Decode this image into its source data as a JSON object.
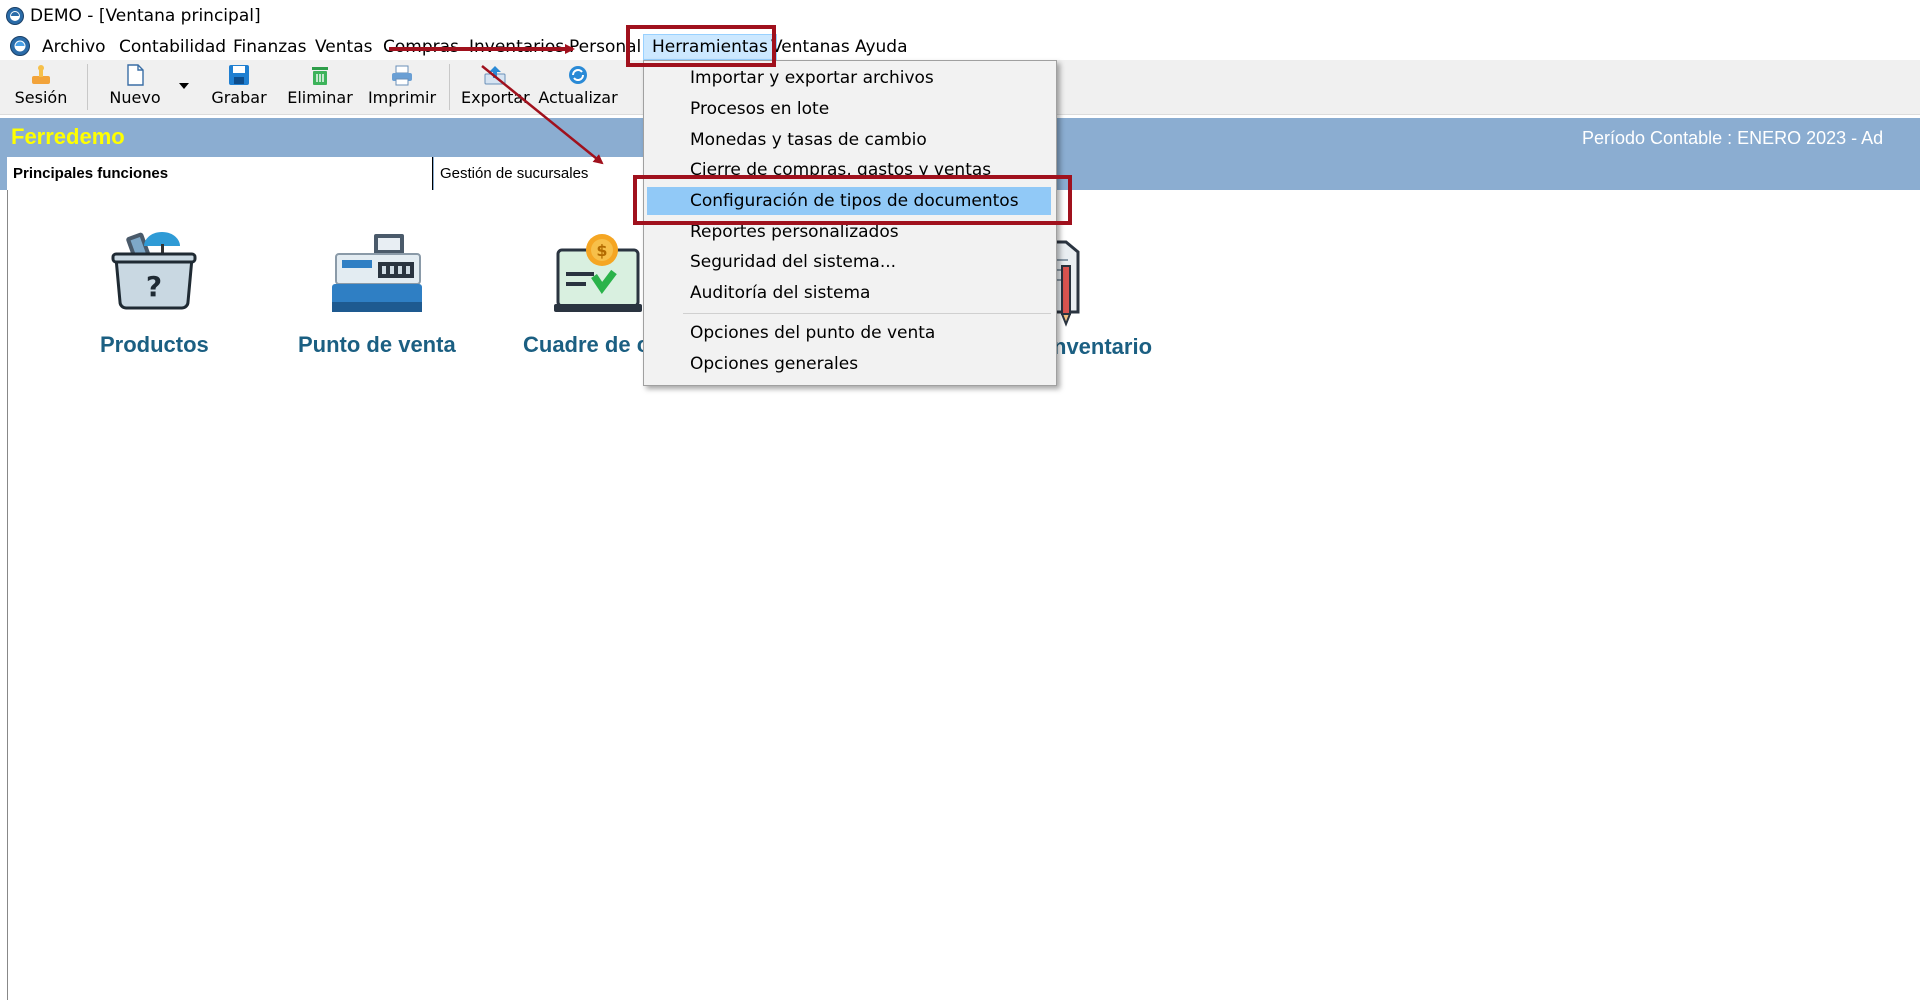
{
  "window": {
    "title": "DEMO - [Ventana principal]"
  },
  "menubar": {
    "items": [
      "Archivo",
      "Contabilidad",
      "Finanzas",
      "Ventas",
      "Compras",
      "Inventarios",
      "Personal",
      "Herramientas",
      "Ventanas",
      "Ayuda"
    ],
    "active": "Herramientas"
  },
  "toolbar": {
    "session": "Sesión",
    "new": "Nuevo",
    "save": "Grabar",
    "delete": "Eliminar",
    "print": "Imprimir",
    "export": "Exportar",
    "refresh": "Actualizar"
  },
  "header": {
    "company": "Ferredemo",
    "period": "Período Contable : ENERO 2023    -    Ad"
  },
  "tabs": [
    "Principales funciones",
    "Gestión de sucursales"
  ],
  "tiles": [
    "Productos",
    "Punto de venta",
    "Cuadre de c",
    "nventario"
  ],
  "dropdown": {
    "items": [
      "Importar y exportar archivos",
      "Procesos en lote",
      "Monedas y tasas de cambio",
      "Cierre de compras, gastos y ventas",
      "Configuración de tipos de documentos",
      "Reportes personalizados",
      "Seguridad del sistema...",
      "Auditoría del sistema",
      "Opciones del punto de venta",
      "Opciones generales"
    ],
    "highlighted": "Configuración de tipos de documentos"
  },
  "colors": {
    "header_band": "#8badd1",
    "company_text": "#ffff00",
    "tile_text": "#1b5f82",
    "highlight": "#91c9f7",
    "annotation": "#a0111d"
  }
}
